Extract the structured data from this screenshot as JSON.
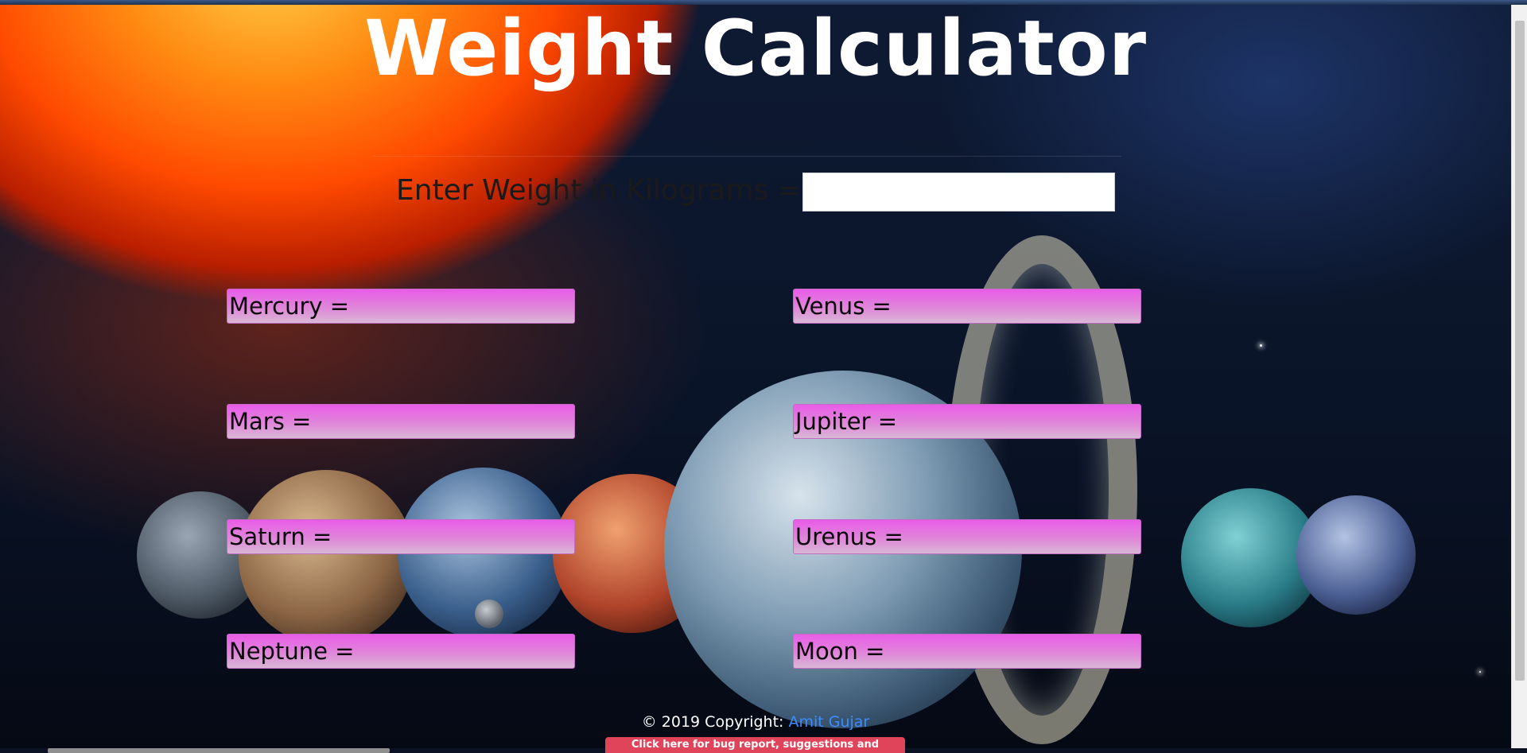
{
  "page": {
    "title": "Weight Calculator"
  },
  "input": {
    "label": "Enter Weight in Kilograms =",
    "value": ""
  },
  "results": {
    "mercury": "Mercury =",
    "venus": "Venus =",
    "mars": "Mars =",
    "jupiter": "Jupiter =",
    "saturn": "Saturn =",
    "urenus": "Urenus =",
    "neptune": "Neptune =",
    "moon": "Moon ="
  },
  "footer": {
    "copyright": "© 2019 Copyright: ",
    "author_link": "Amit Gujar",
    "bug_button": "Click here for bug report, suggestions and feedback"
  },
  "colors": {
    "result_bar": "#e85ce8",
    "link": "#3d8bff",
    "bug_button": "#e0445a"
  }
}
